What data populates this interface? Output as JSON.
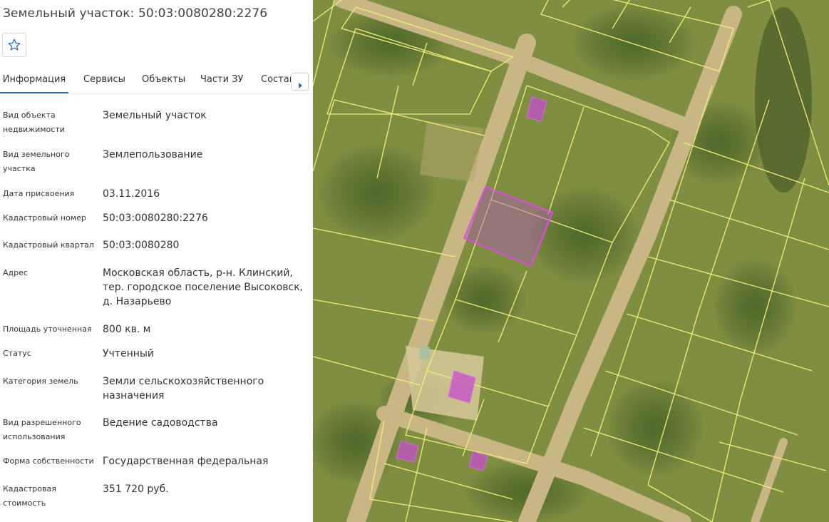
{
  "title": "Земельный участок: 50:03:0080280:2276",
  "favorite_icon": "star-outline-icon",
  "tabs": [
    {
      "label": "Информация"
    },
    {
      "label": "Сервисы"
    },
    {
      "label": "Объекты"
    },
    {
      "label": "Части ЗУ"
    },
    {
      "label": "Состав"
    }
  ],
  "tab_scroll_icon": "arrow-right-icon",
  "info": [
    {
      "label": "Вид объекта недвижимости",
      "value": "Земельный участок"
    },
    {
      "label": "Вид земельного участка",
      "value": "Землепользование"
    },
    {
      "label": "Дата присвоения",
      "value": "03.11.2016"
    },
    {
      "label": "Кадастровый номер",
      "value": "50:03:0080280:2276"
    },
    {
      "label": "Кадастровый квартал",
      "value": "50:03:0080280"
    },
    {
      "label": "Адрес",
      "value": "Московская область, р-н. Клинский, тер. городское поселение Высоковск, д. Назарьево"
    },
    {
      "label": "Площадь уточненная",
      "value": "800 кв. м"
    },
    {
      "label": "Статус",
      "value": "Учтенный"
    },
    {
      "label": "Категория земель",
      "value": "Земли сельскохозяйственного назначения"
    },
    {
      "label": "Вид разрешенного использования",
      "value": "Ведение садоводства"
    },
    {
      "label": "Форма собственности",
      "value": "Государственная федеральная"
    },
    {
      "label": "Кадастровая стоимость",
      "value": "351 720 руб."
    }
  ],
  "colors": {
    "accent": "#2f6fb0",
    "parcel_border": "#f0ee7a",
    "selected_parcel": "#d14fd8",
    "building": "#c64ccd",
    "grass": "#7d8a3c",
    "road": "#cdb988"
  }
}
